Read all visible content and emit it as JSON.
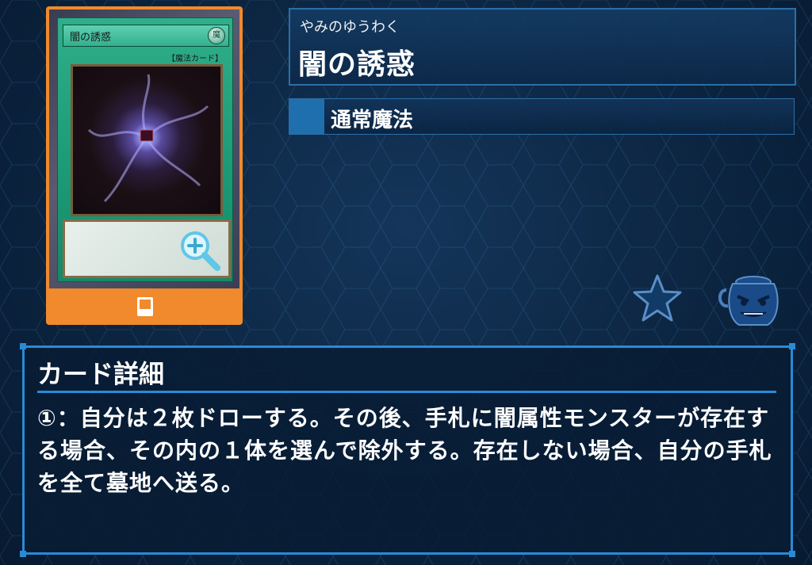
{
  "card": {
    "name_on_card": "闇の誘惑",
    "attribute_glyph": "魔",
    "type_on_card": "【魔法カード】",
    "kind_icon": "spell-card-icon",
    "zoom_icon": "zoom-in-icon"
  },
  "header": {
    "ruby": "やみのゆうわく",
    "title": "闇の誘惑",
    "subtype": "通常魔法"
  },
  "actions": {
    "favorite_icon": "star-icon",
    "pot_icon": "pot-of-greed-icon"
  },
  "detail": {
    "heading": "カード詳細",
    "text": "①：自分は２枚ドローする。その後、手札に闇属性モンスターが存在する場合、その内の１体を選んで除外する。存在しない場合、自分の手札を全て墓地へ送る。"
  },
  "colors": {
    "accent_orange": "#f08a2c",
    "panel_border": "#2a8ad6",
    "spell_green": "#1e9d78"
  }
}
